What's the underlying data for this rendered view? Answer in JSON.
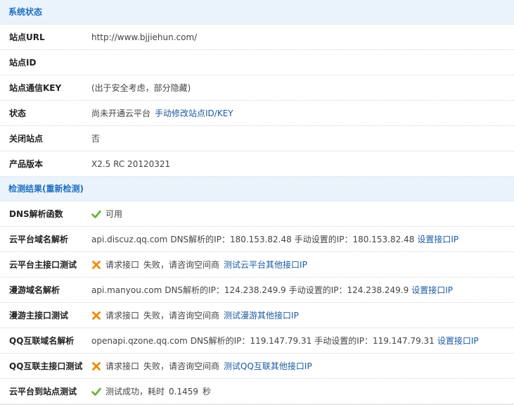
{
  "system_status": {
    "title": "系统状态",
    "rows": {
      "site_url": {
        "label": "站点URL",
        "value": "http://www.bjjiehun.com/"
      },
      "site_id": {
        "label": "站点ID",
        "value": ""
      },
      "site_key": {
        "label": "站点通信KEY",
        "value": "(出于安全考虑，部分隐藏)"
      },
      "status": {
        "label": "状态",
        "value": "尚未开通云平台",
        "link": "手动修改站点ID/KEY"
      },
      "site_closed": {
        "label": "关闭站点",
        "value": "否"
      },
      "product_version": {
        "label": "产品版本",
        "value": "X2.5 RC 20120321"
      }
    }
  },
  "detection": {
    "title": "检测结果(重新检测)",
    "rows": {
      "dns_func": {
        "label": "DNS解析函数",
        "icon": "check-icon",
        "value": "可用"
      },
      "cloud_domain": {
        "label": "云平台域名解析",
        "domain": "api.discuz.qq.com",
        "dns_label": "DNS解析的IP：",
        "dns_ip": "180.153.82.48",
        "manual_label": "手动设置的IP：",
        "manual_ip": "180.153.82.48",
        "link": "设置接口IP"
      },
      "cloud_main": {
        "label": "云平台主接口测试",
        "icon": "cross-icon",
        "text1": "请求接口",
        "text2": "失败，请咨询空间商",
        "link": "测试云平台其他接口IP"
      },
      "manyou_domain": {
        "label": "漫游域名解析",
        "domain": "api.manyou.com",
        "dns_label": "DNS解析的IP：",
        "dns_ip": "124.238.249.9",
        "manual_label": "手动设置的IP：",
        "manual_ip": "124.238.249.9",
        "link": "设置接口IP"
      },
      "manyou_main": {
        "label": "漫游主接口测试",
        "icon": "cross-icon",
        "text1": "请求接口",
        "text2": "失败，请咨询空间商",
        "link": "测试漫游其他接口IP"
      },
      "qq_domain": {
        "label": "QQ互联域名解析",
        "domain": "openapi.qzone.qq.com",
        "dns_label": "DNS解析的IP：",
        "dns_ip": "119.147.79.31",
        "manual_label": "手动设置的IP：",
        "manual_ip": "119.147.79.31",
        "link": "设置接口IP"
      },
      "qq_main": {
        "label": "QQ互联主接口测试",
        "icon": "cross-icon",
        "text1": "请求接口",
        "text2": "失败，请咨询空间商",
        "link": "测试QQ互联其他接口IP"
      },
      "cloud_to_site": {
        "label": "云平台到站点测试",
        "icon": "check-icon",
        "text1": "测试成功，耗时",
        "time": "0.1459",
        "unit": "秒"
      }
    }
  },
  "colors": {
    "header_bg": "#eaf3fb",
    "header_text": "#1f6fbf",
    "link": "#1c5aa0",
    "success": "#5cb531",
    "error": "#f08a00"
  }
}
